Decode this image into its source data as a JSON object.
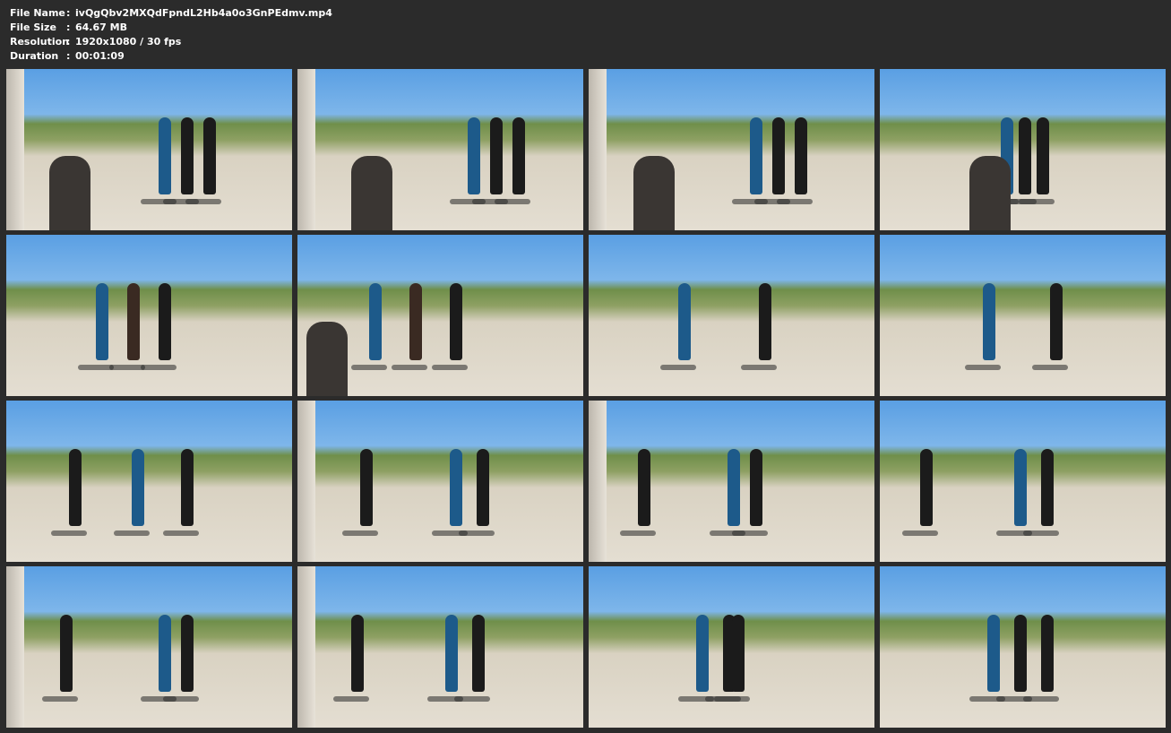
{
  "info": {
    "file_name_label": "File Name",
    "file_name": "ivQgQbv2MXQdFpndL2Hb4a0o3GnPEdmv.mp4",
    "file_size_label": "File Size",
    "file_size": "64.67 MB",
    "resolution_label": "Resolution",
    "resolution": "1920x1080 / 30 fps",
    "duration_label": "Duration",
    "duration": "00:01:09",
    "separator": ":"
  },
  "thumbnail_count": 16,
  "colors": {
    "background": "#2b2b2b",
    "text": "#ffffff",
    "sky": "#5a9fe3",
    "sand": "#e4ded2",
    "grass": "#8ea063"
  }
}
